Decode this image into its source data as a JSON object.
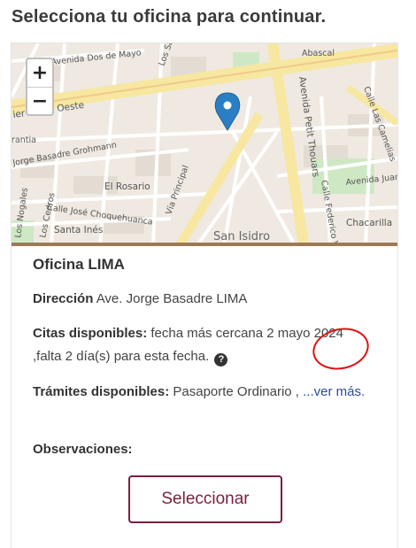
{
  "page": {
    "title": "Selecciona tu oficina para continuar."
  },
  "map": {
    "zoom_in": "+",
    "zoom_out": "−",
    "labels": {
      "avenida_dos_de_mayo": "Avenida Dos de Mayo",
      "los_sauces": "Los Sauces",
      "abascal": "Abascal",
      "pier_prado_oeste": "ier Prado Oeste",
      "avenida_petit_thouars": "Avenida Petit Thouars",
      "calle_las_camelias": "Calle Las Camelias",
      "rantia": "rantia",
      "jorge_basadre_grohmann": "Jorge Basadre Grohmann",
      "el_rosario": "El Rosario",
      "via_principal": "Vía Principal",
      "calle_federico_villarreal": "Calle Federico Villarreal",
      "avenida_juan": "Avenida Juan",
      "calle_jose_choquehuanca": "Calle José Choquehuanca",
      "los_cedros": "Los Cedros",
      "los_nogales": "Los Nogales",
      "santa_ines": "Santa Inés",
      "san_isidro": "San Isidro",
      "chacarilla": "Chacarilla"
    }
  },
  "office": {
    "name": "Oficina LIMA",
    "address_label": "Dirección",
    "address_value": "Ave. Jorge Basadre LIMA",
    "citas_label": "Citas disponibles:",
    "citas_value": "fecha más cercana 2 mayo 2024 ,falta 2 día(s) para esta fecha.",
    "tramites_label": "Trámites disponibles:",
    "tramites_value": "Pasaporte Ordinario ,",
    "ver_mas": "...ver más.",
    "observaciones_label": "Observaciones:",
    "select_button": "Seleccionar"
  },
  "colors": {
    "accent": "#7a1f3d",
    "link": "#2b4a9c",
    "marker": "#2a7fc4",
    "annotation": "#e01010"
  }
}
